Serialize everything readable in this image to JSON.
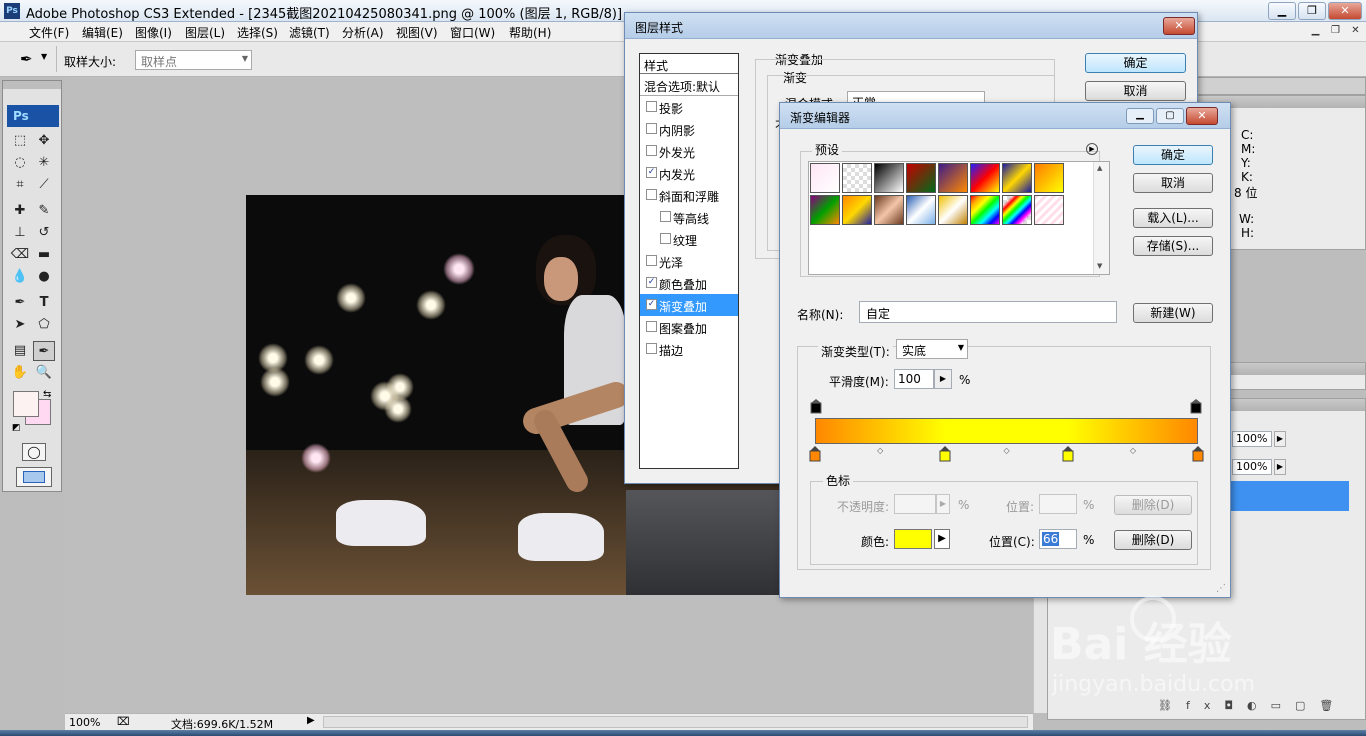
{
  "window": {
    "title": "Adobe Photoshop CS3 Extended - [2345截图20210425080341.png @ 100% (图层 1, RGB/8)]",
    "app_icon": "Ps"
  },
  "menu": [
    "文件(F)",
    "编辑(E)",
    "图像(I)",
    "图层(L)",
    "选择(S)",
    "滤镜(T)",
    "分析(A)",
    "视图(V)",
    "窗口(W)",
    "帮助(H)"
  ],
  "options": {
    "sample_size_label": "取样大小:",
    "sample_size_value": "取样点"
  },
  "toolbox": {
    "logo": "Ps"
  },
  "status": {
    "zoom": "100%",
    "doc_info": "文档:699.6K/1.52M"
  },
  "info_panel": {
    "labels": [
      "C:",
      "M:",
      "Y:",
      "K:",
      "8 位",
      "W:",
      "H:"
    ]
  },
  "layers_panel": {
    "opacity": "100%",
    "fill": "100%"
  },
  "layer_style": {
    "title": "图层样式",
    "styles_header": "样式",
    "blend_default": "混合选项:默认",
    "items": [
      {
        "label": "投影",
        "checked": false,
        "indent": false
      },
      {
        "label": "内阴影",
        "checked": false,
        "indent": false
      },
      {
        "label": "外发光",
        "checked": false,
        "indent": false
      },
      {
        "label": "内发光",
        "checked": true,
        "indent": false
      },
      {
        "label": "斜面和浮雕",
        "checked": false,
        "indent": false
      },
      {
        "label": "等高线",
        "checked": false,
        "indent": true
      },
      {
        "label": "纹理",
        "checked": false,
        "indent": true
      },
      {
        "label": "光泽",
        "checked": false,
        "indent": false
      },
      {
        "label": "颜色叠加",
        "checked": true,
        "indent": false
      },
      {
        "label": "渐变叠加",
        "checked": true,
        "indent": false,
        "selected": true
      },
      {
        "label": "图案叠加",
        "checked": false,
        "indent": false
      },
      {
        "label": "描边",
        "checked": false,
        "indent": false
      }
    ],
    "section_title": "渐变叠加",
    "sub_title": "渐变",
    "blend_mode_label": "混合模式",
    "blend_mode_value": "正常",
    "opacity_label_partial": "不",
    "ok": "确定",
    "cancel": "取消"
  },
  "gradient_editor": {
    "title": "渐变编辑器",
    "presets_label": "预设",
    "ok": "确定",
    "cancel": "取消",
    "load": "载入(L)...",
    "save": "存储(S)...",
    "name_label": "名称(N):",
    "name_value": "自定",
    "new_button": "新建(W)",
    "type_label": "渐变类型(T):",
    "type_value": "实底",
    "smooth_label": "平滑度(M):",
    "smooth_value": "100",
    "percent": "%",
    "stops_title": "色标",
    "opacity_label": "不透明度:",
    "location_label": "位置:",
    "delete_label": "删除(D)",
    "color_label": "颜色:",
    "color_location_label": "位置(C):",
    "color_location_value": "66",
    "color_value": "#ffff00",
    "gradient_colors": [
      "#ff8800",
      "#ffff00",
      "#ffff00",
      "#ff8800"
    ],
    "gradient_positions": [
      0,
      34,
      66,
      100
    ]
  },
  "watermark": {
    "brand": "Bai  经验",
    "url": "jingyan.baidu.com"
  }
}
